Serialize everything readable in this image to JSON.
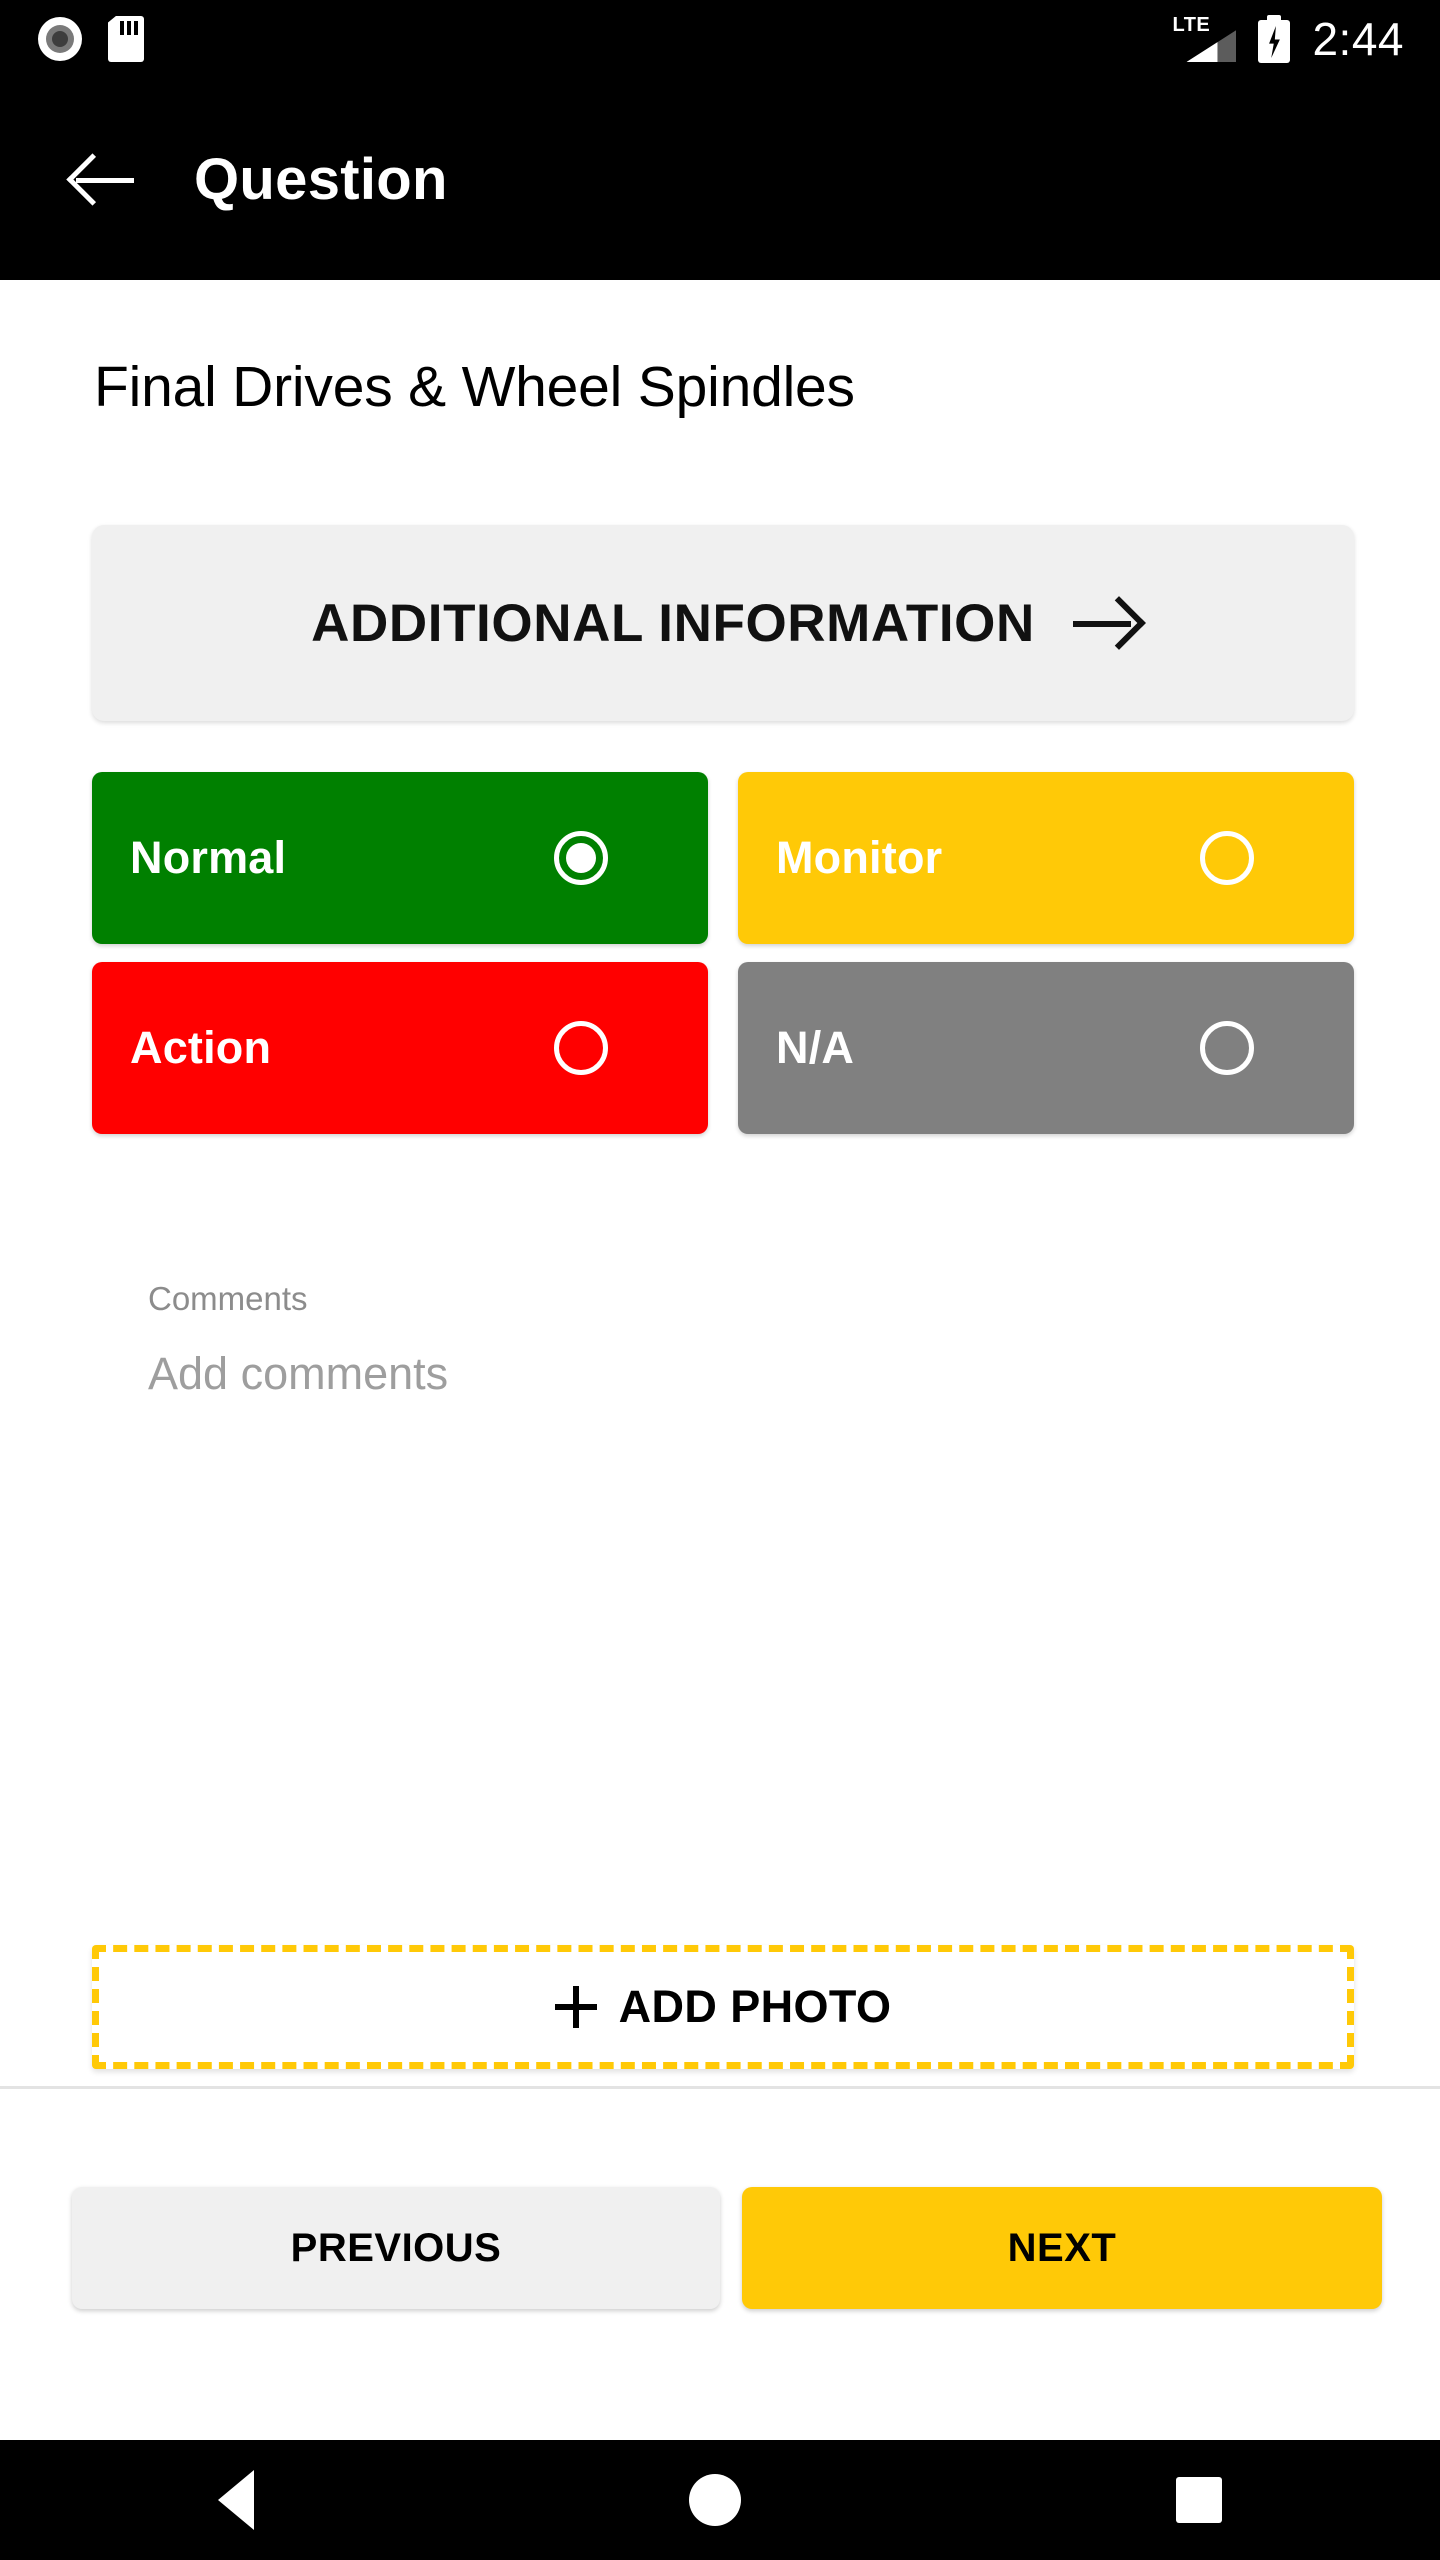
{
  "status_bar": {
    "left_icons": [
      "screen-record-icon",
      "sd-card-icon"
    ],
    "network_label": "LTE",
    "right_icons": [
      "signal-icon",
      "battery-charging-icon"
    ],
    "clock": "2:44"
  },
  "app_bar": {
    "back_icon": "back-arrow-icon",
    "title": "Question"
  },
  "main": {
    "page_title": "Final Drives & Wheel Spindles",
    "additional_information": {
      "label": "ADDITIONAL INFORMATION",
      "icon": "arrow-right-icon"
    },
    "status_options": [
      {
        "label": "Normal",
        "color": "#008000",
        "selected": true
      },
      {
        "label": "Monitor",
        "color": "#ffc907",
        "selected": false
      },
      {
        "label": "Action",
        "color": "#ff0000",
        "selected": false
      },
      {
        "label": "N/A",
        "color": "#808080",
        "selected": false
      }
    ],
    "comments": {
      "label": "Comments",
      "value": "",
      "placeholder": "Add comments"
    },
    "add_photo": {
      "label": "ADD PHOTO",
      "icon": "plus-icon",
      "border_color": "#ffc907"
    }
  },
  "footer": {
    "previous_label": "PREVIOUS",
    "next_label": "NEXT",
    "next_color": "#ffc907"
  },
  "nav_bar": {
    "back_icon": "triangle-back-icon",
    "home_icon": "circle-home-icon",
    "recents_icon": "square-recents-icon"
  }
}
